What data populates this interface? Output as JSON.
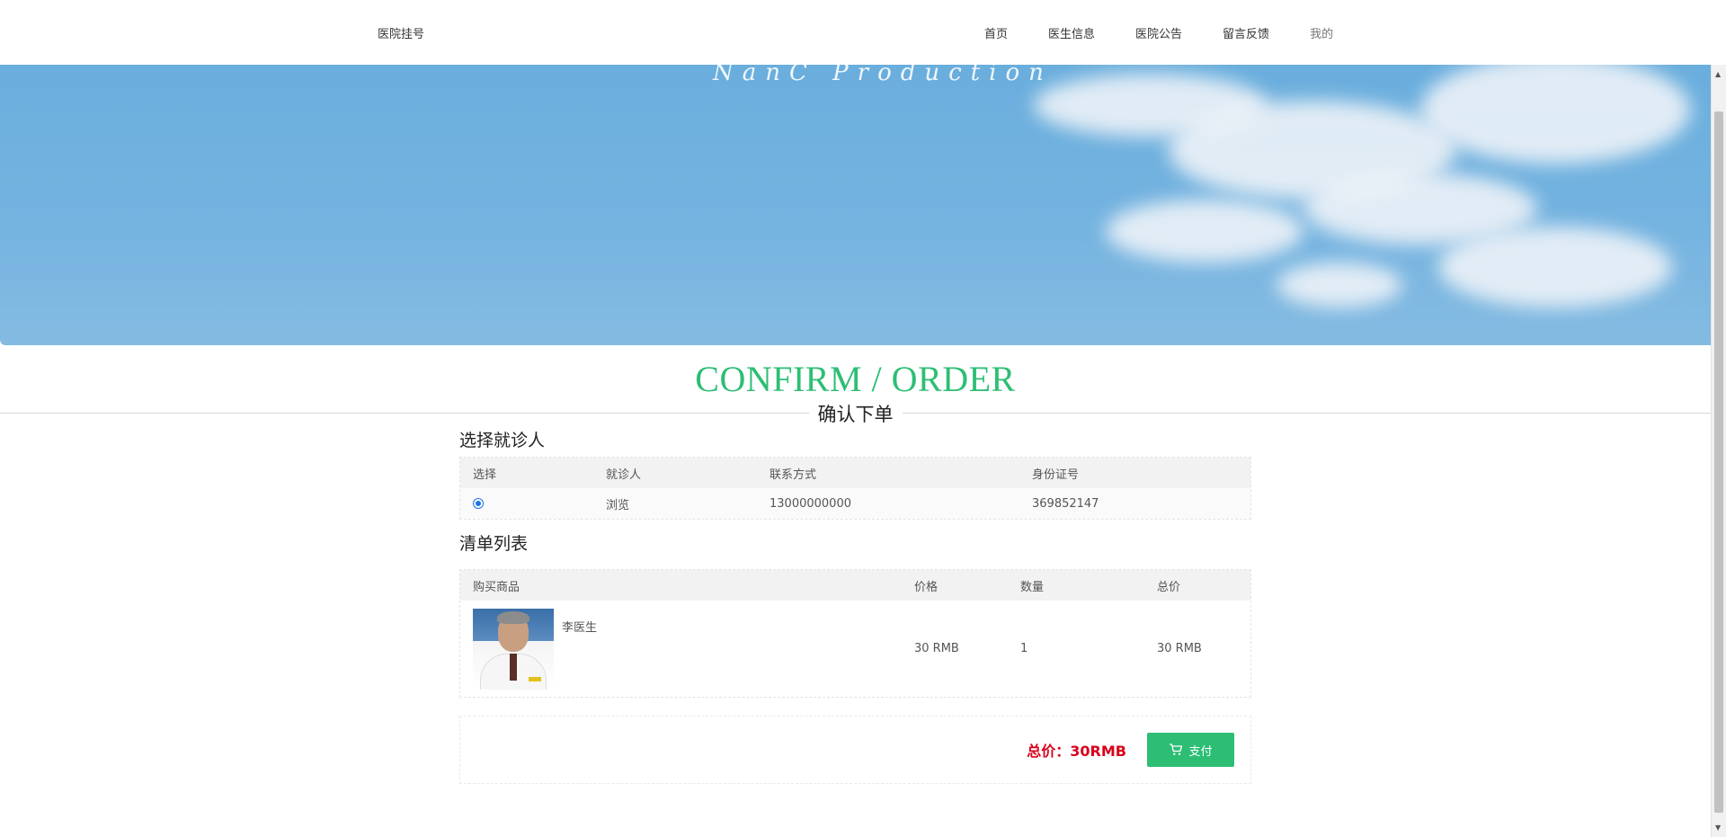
{
  "header": {
    "brand": "医院挂号",
    "nav": [
      "首页",
      "医生信息",
      "医院公告",
      "留言反馈",
      "我的"
    ]
  },
  "banner": {
    "text": "NanC  Production"
  },
  "page": {
    "title": "CONFIRM / ORDER",
    "subtitle": "确认下单"
  },
  "patients": {
    "heading": "选择就诊人",
    "columns": [
      "选择",
      "就诊人",
      "联系方式",
      "身份证号"
    ],
    "rows": [
      {
        "selected": true,
        "name": "浏览",
        "phone": "13000000000",
        "id_number": "369852147"
      }
    ]
  },
  "order": {
    "heading": "清单列表",
    "columns": [
      "购买商品",
      "价格",
      "数量",
      "总价"
    ],
    "items": [
      {
        "name": "李医生",
        "price": "30 RMB",
        "quantity": "1",
        "total": "30 RMB"
      }
    ]
  },
  "summary": {
    "total_label": "总价：30RMB",
    "pay_label": "支付"
  },
  "colors": {
    "accent": "#2dbe74",
    "price_red": "#d9001b",
    "banner_sky": "#74b3e0"
  }
}
